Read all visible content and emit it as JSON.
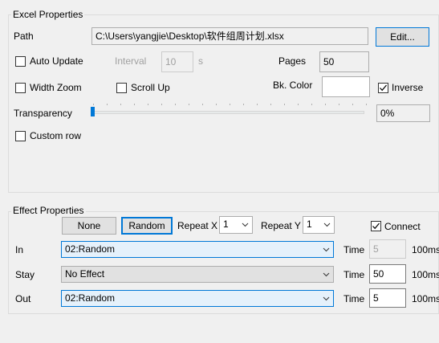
{
  "excel_group": {
    "title": "Excel Properties"
  },
  "path": {
    "label": "Path",
    "value": "C:\\Users\\yangjie\\Desktop\\软件组周计划.xlsx",
    "edit_label": "Edit..."
  },
  "auto_update": {
    "label": "Auto Update",
    "checked": false,
    "interval_label": "Interval",
    "interval_value": "10",
    "interval_unit": "s"
  },
  "pages": {
    "label": "Pages",
    "value": "50"
  },
  "width_zoom": {
    "label": "Width Zoom",
    "checked": false
  },
  "scroll_up": {
    "label": "Scroll Up",
    "checked": false
  },
  "bk_color": {
    "label": "Bk. Color",
    "value": "#ffffff"
  },
  "inverse": {
    "label": "Inverse",
    "checked": true
  },
  "transparency": {
    "label": "Transparency",
    "value": "0%",
    "level": 0
  },
  "custom_row": {
    "label": "Custom row",
    "checked": false
  },
  "effect_group": {
    "title": "Effect Properties"
  },
  "effect_buttons": {
    "none_label": "None",
    "random_label": "Random"
  },
  "repeat_x": {
    "label": "Repeat X",
    "value": "1"
  },
  "repeat_y": {
    "label": "Repeat Y",
    "value": "1"
  },
  "connect": {
    "label": "Connect",
    "checked": true
  },
  "effects": [
    {
      "label": "In",
      "value": "02:Random",
      "time_label": "Time",
      "time_value": "5",
      "unit": "100ms",
      "time_disabled": true
    },
    {
      "label": "Stay",
      "value": "No Effect",
      "time_label": "Time",
      "time_value": "50",
      "unit": "100ms",
      "time_disabled": false
    },
    {
      "label": "Out",
      "value": "02:Random",
      "time_label": "Time",
      "time_value": "5",
      "unit": "100ms",
      "time_disabled": false
    }
  ],
  "icons": {
    "checkmark": "checkmark-icon",
    "dropdown": "chevron-down-icon"
  },
  "colors": {
    "accent": "#0078d7",
    "disabled_text": "#a0a0a0"
  }
}
